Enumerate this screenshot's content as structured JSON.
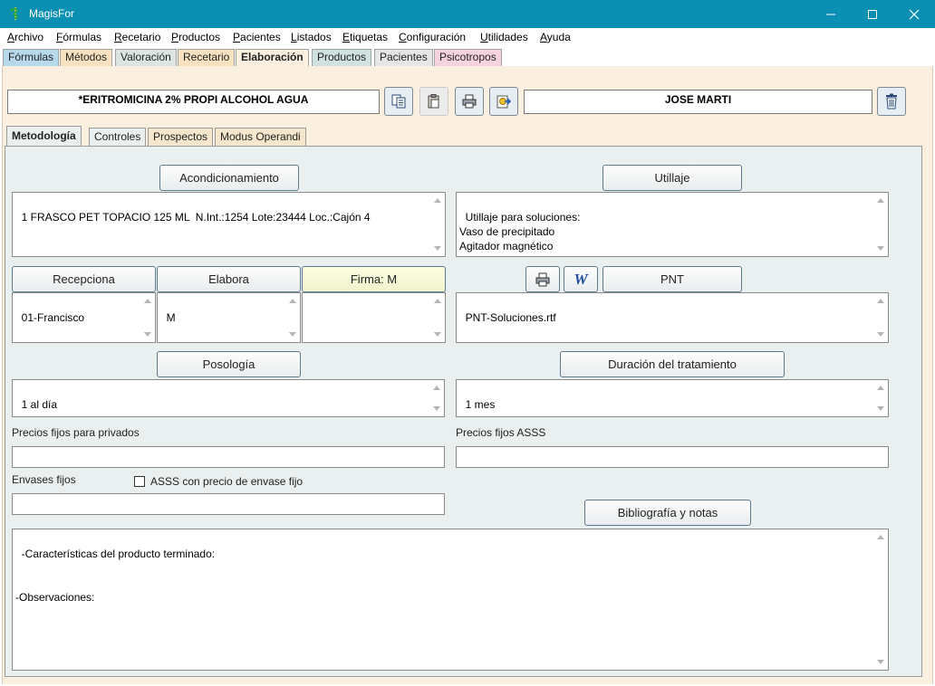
{
  "window": {
    "title": "MagisFor",
    "app_icon": "snake-staff-icon"
  },
  "menu": [
    {
      "label": "Archivo"
    },
    {
      "label": "Fórmulas"
    },
    {
      "label": "Recetario"
    },
    {
      "label": "Productos"
    },
    {
      "label": "Pacientes"
    },
    {
      "label": "Listados"
    },
    {
      "label": "Etiquetas"
    },
    {
      "label": "Configuración"
    },
    {
      "label": "Utilidades"
    },
    {
      "label": "Ayuda"
    }
  ],
  "main_tabs": [
    {
      "label": "Fórmulas",
      "color": "#b7d9ec"
    },
    {
      "label": "Métodos",
      "color": "#f7e1bf"
    },
    {
      "label": "Valoración",
      "color": "#dce5e3"
    },
    {
      "label": "Recetario",
      "color": "#f7e1bf"
    },
    {
      "label": "Elaboración",
      "color": "#fbf0e0",
      "active": true
    },
    {
      "label": "Productos",
      "color": "#cfe2e0"
    },
    {
      "label": "Pacientes",
      "color": "#e6e6e6"
    },
    {
      "label": "Psicotropos",
      "color": "#f6d3dd"
    }
  ],
  "header": {
    "formula": "*ERITROMICINA 2% PROPI ALCOHOL AGUA",
    "patient": "JOSE MARTI",
    "toolbar_icons": [
      "copy-icon",
      "paste-icon",
      "print-icon",
      "export-icon",
      "delete-icon"
    ]
  },
  "sub_tabs": [
    {
      "label": "Metodología",
      "active": true
    },
    {
      "label": "Controles"
    },
    {
      "label": "Prospectos"
    },
    {
      "label": "Modus Operandi"
    }
  ],
  "panel": {
    "acondicionamiento_btn": "Acondicionamiento",
    "acondicionamiento_text": "1 FRASCO PET TOPACIO 125 ML  N.Int.:1254 Lote:23444 Loc.:Cajón 4",
    "utillaje_btn": "Utillaje",
    "utillaje_text": "Utillaje para soluciones:\nVaso de precipitado\nAgitador magnético\nImán",
    "recepciona_btn": "Recepciona",
    "recepciona_text": "01-Francisco",
    "elabora_btn": "Elabora",
    "elabora_text": "M",
    "firma_btn": "Firma: M",
    "firma_text": "",
    "pnt_btn": "PNT",
    "pnt_text": "PNT-Soluciones.rtf",
    "word_icon_glyph": "W",
    "posologia_btn": "Posología",
    "posologia_text": "1 al día",
    "duracion_btn": "Duración del tratamiento",
    "duracion_text": "1 mes",
    "precios_privados_label": "Precios fijos para privados",
    "precios_privados_value": "",
    "precios_asss_label": "Precios fijos ASSS",
    "precios_asss_value": "",
    "envases_label": "Envases fijos",
    "envases_value": "",
    "asss_checkbox_label": "ASSS con precio de envase fijo",
    "asss_checkbox_checked": false,
    "bibliografia_btn": "Bibliografía y notas",
    "notas_text": "-Características del producto terminado:\n\n\n-Observaciones:"
  }
}
